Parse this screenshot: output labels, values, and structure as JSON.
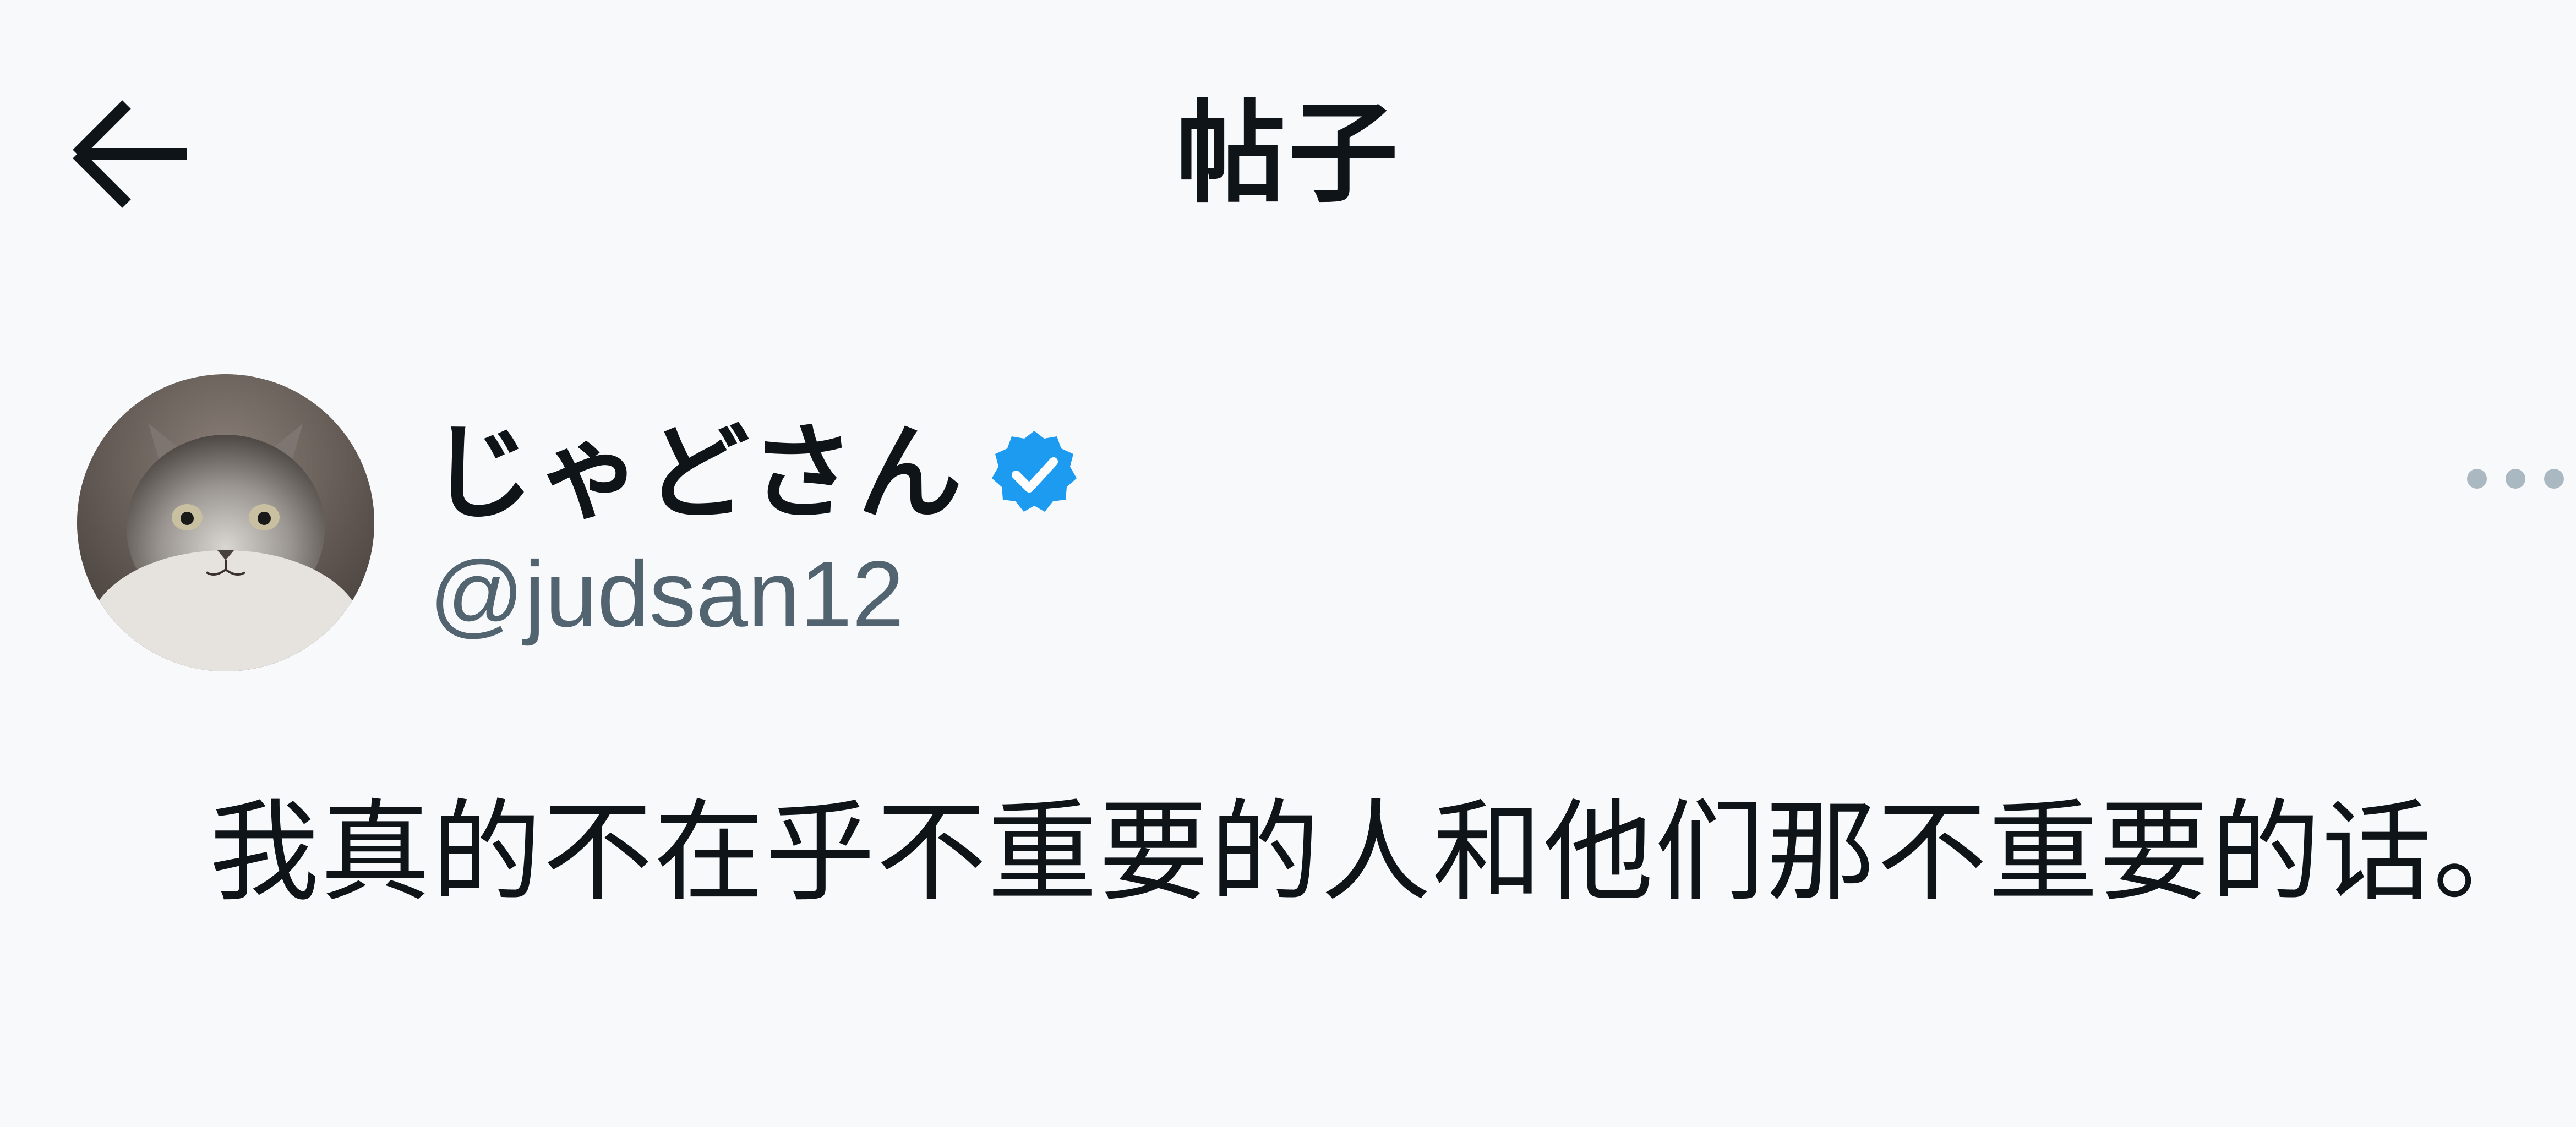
{
  "header": {
    "back_icon": "arrow-left-icon",
    "title": "帖子"
  },
  "post": {
    "author": {
      "display_name": "じゃどさん",
      "handle": "@judsan12",
      "verified": true,
      "verified_icon": "verified-badge-icon",
      "avatar_icon": "cat-avatar"
    },
    "more_icon": "more-horizontal-icon",
    "text": "我真的不在乎不重要的人和他们那不重要的话。"
  },
  "colors": {
    "background": "#f7f9fb",
    "text": "#0f1419",
    "secondary_text": "#536471",
    "verified_blue": "#1d9bf0",
    "more_dots": "#aab8c2"
  }
}
